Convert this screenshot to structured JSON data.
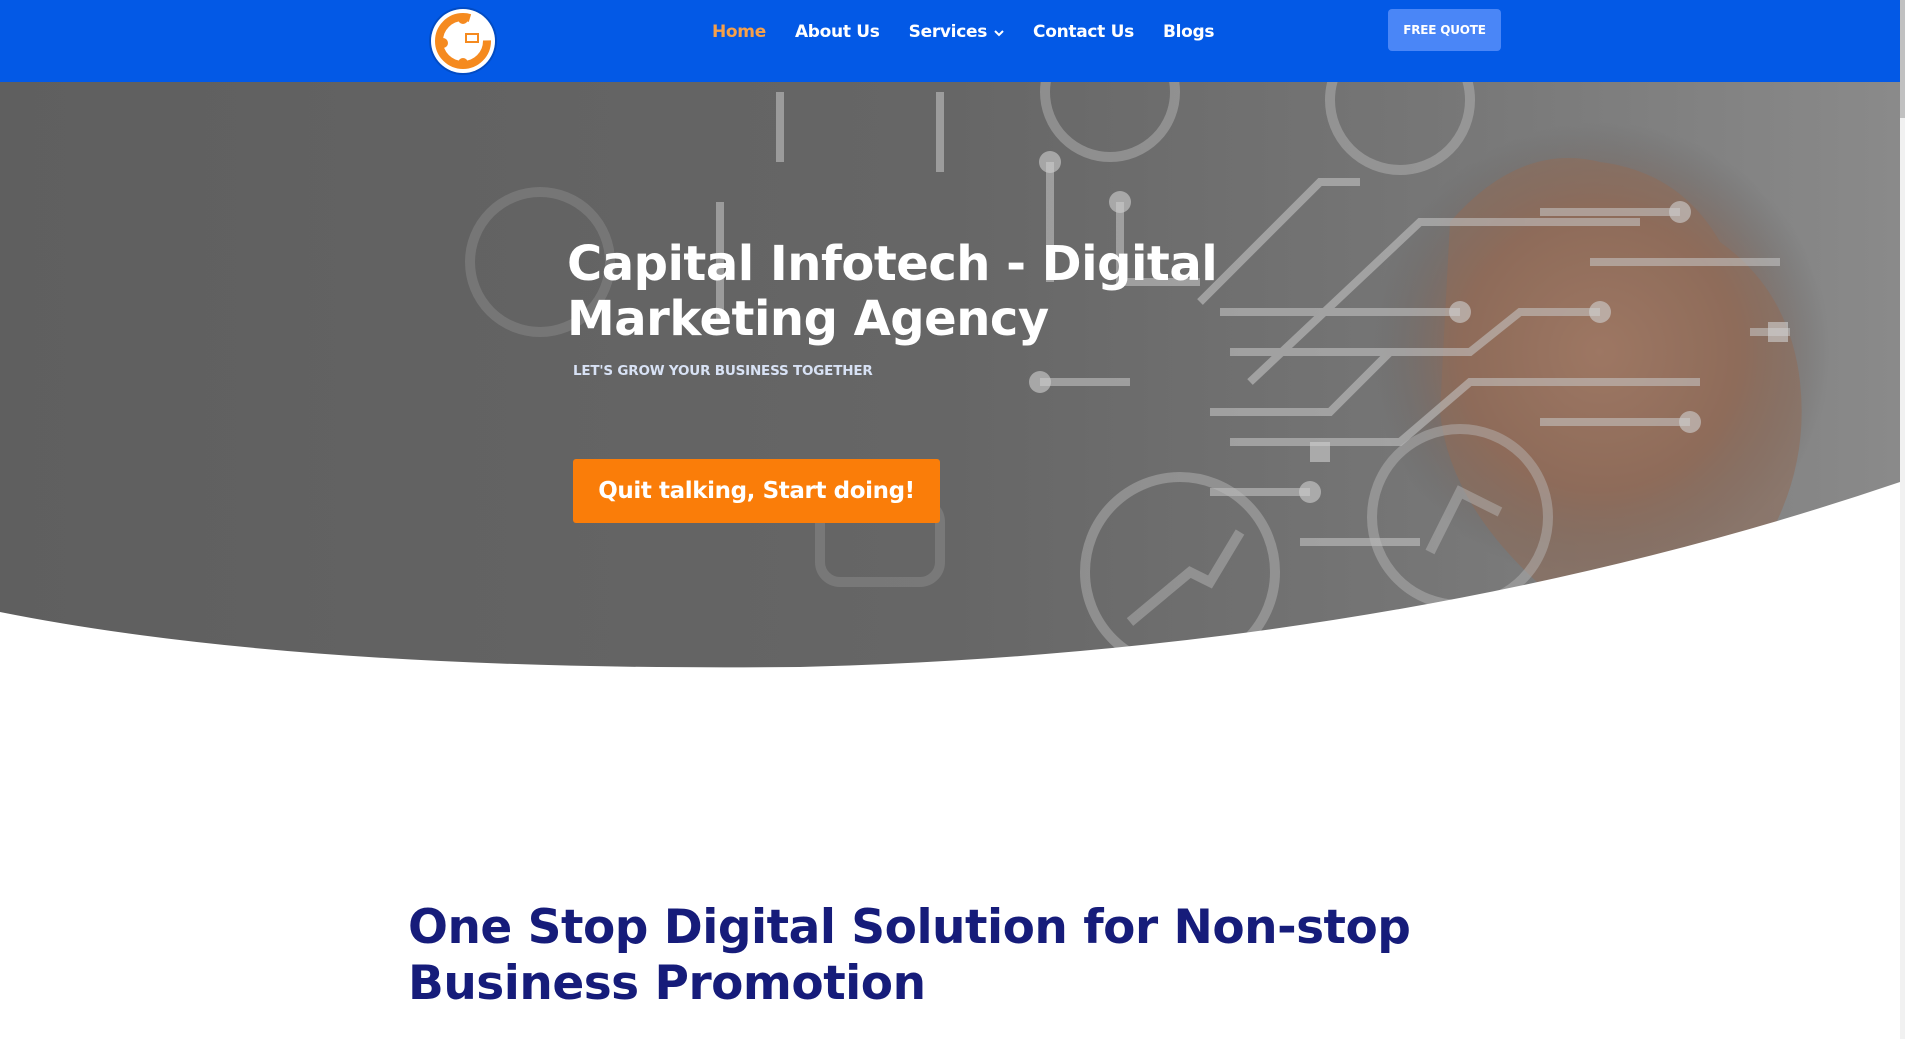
{
  "header": {
    "logo_icon": "capital-infotech-logo",
    "nav": [
      {
        "label": "Home",
        "active": true
      },
      {
        "label": "About Us"
      },
      {
        "label": "Services",
        "has_dropdown": true
      },
      {
        "label": "Contact Us"
      },
      {
        "label": "Blogs"
      }
    ],
    "cta_label": "FREE QUOTE"
  },
  "hero": {
    "title_line1": "Capital Infotech - Digital",
    "title_line2": "Marketing Agency",
    "subtitle": "LET'S GROW YOUR BUSINESS TOGETHER",
    "button_label": "Quit talking, Start doing!"
  },
  "section": {
    "title_line1": "One Stop Digital Solution for Non-stop",
    "title_line2": "Business Promotion"
  },
  "colors": {
    "header_bg": "#0359e6",
    "nav_active": "#f6a04a",
    "quote_button": "#4a86f7",
    "cta_button": "#fa7d09",
    "section_title": "#161c7a"
  }
}
